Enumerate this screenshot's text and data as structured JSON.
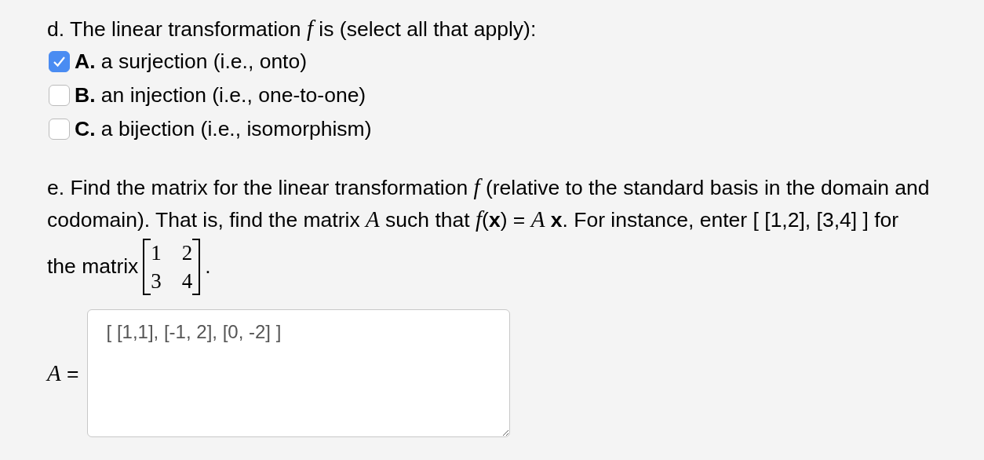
{
  "question_d": {
    "prompt": "d. The linear transformation *f* is (select all that apply):",
    "options": [
      {
        "label": "**A.** a surjection (i.e., onto)",
        "checked": true
      },
      {
        "label": "**B.** an injection (i.e., one-to-one)",
        "checked": false
      },
      {
        "label": "**C.** a bijection (i.e., isomorphism)",
        "checked": false
      }
    ]
  },
  "question_e": {
    "prompt": "e. Find the matrix for the linear transformation *f* (relative to the standard basis in the domain and codomain). That is, find the matrix *A* such that *f*(**x**) = *A* **x**. For instance, enter [ [1,2], [3,4] ] for",
    "matrix_intro": "the matrix",
    "matrix": [
      [
        "1",
        "2"
      ],
      [
        "3",
        "4"
      ]
    ],
    "matrix_end": ".",
    "answer_label": "*A* =",
    "answer_value": "[ [1,1], [-1, 2], [0, -2] ]"
  }
}
